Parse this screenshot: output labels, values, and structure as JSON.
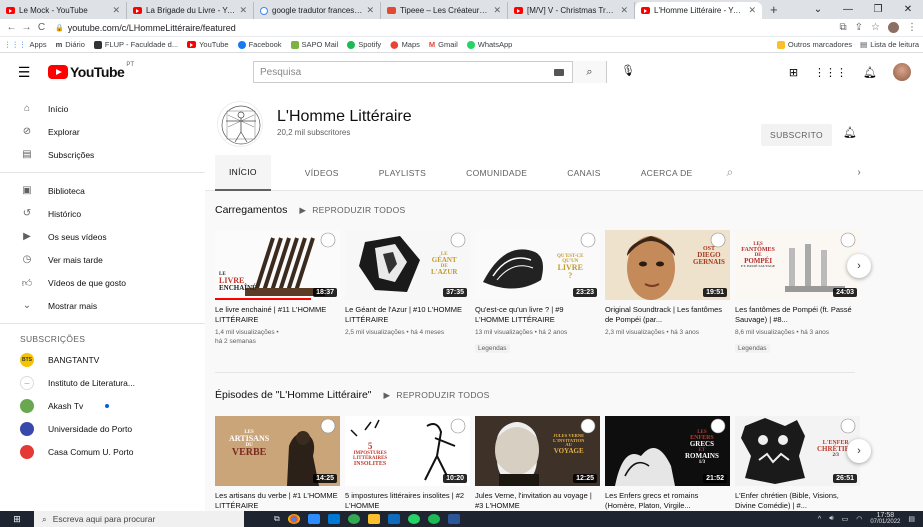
{
  "browser": {
    "tabs": [
      {
        "title": "Le Mock - YouTube",
        "icon": "youtube-icon"
      },
      {
        "title": "La Brigade du Livre - YouTu",
        "icon": "youtube-icon"
      },
      {
        "title": "google tradutor frances - N",
        "icon": "google-icon"
      },
      {
        "title": "Tipeee – Les Créateurs Litt",
        "icon": "tipeee-icon"
      },
      {
        "title": "[M/V] V - Christmas Tree :",
        "icon": "youtube-icon"
      },
      {
        "title": "L'Homme Littéraire - YouTu",
        "icon": "youtube-icon"
      }
    ],
    "url": "youtube.com/c/LHommeLittéraire/featured",
    "bookmarks": [
      "Apps",
      "Diário",
      "FLUP - Faculdade d...",
      "YouTube",
      "Facebook",
      "SAPO Mail",
      "Spotify",
      "Maps",
      "Gmail",
      "WhatsApp"
    ],
    "bookmarks_right": [
      "Outros marcadores",
      "Lista de leitura"
    ]
  },
  "youtube": {
    "logo_text": "YouTube",
    "logo_region": "PT",
    "search_placeholder": "Pesquisa"
  },
  "sidebar": {
    "main": [
      "Início",
      "Explorar",
      "Subscrições"
    ],
    "library": [
      "Biblioteca",
      "Histórico",
      "Os seus vídeos",
      "Ver mais tarde",
      "Vídeos de que gosto",
      "Mostrar mais"
    ],
    "subs_heading": "SUBSCRIÇÕES",
    "subs": [
      {
        "name": "BANGTANTV",
        "color": "#f5c400",
        "badge": "BTS"
      },
      {
        "name": "Instituto de Literatura...",
        "color": "#ffffff",
        "badge": ""
      },
      {
        "name": "Akash Tv",
        "color": "#6aa84f",
        "badge": ""
      },
      {
        "name": "Universidade do Porto",
        "color": "#3949ab",
        "badge": ""
      },
      {
        "name": "Casa Comum U. Porto",
        "color": "#e53935",
        "badge": ""
      }
    ]
  },
  "channel": {
    "name": "L'Homme Littéraire",
    "subscribers": "20,2 mil subscritores",
    "subscribe_label": "SUBSCRITO",
    "tabs": [
      "INÍCIO",
      "VÍDEOS",
      "PLAYLISTS",
      "COMUNIDADE",
      "CANAIS",
      "ACERCA DE"
    ]
  },
  "sections": [
    {
      "title": "Carregamentos",
      "play_all": "REPRODUZIR TODOS",
      "videos": [
        {
          "title": "Le livre enchainé | #11 L'HOMME LITTÉRAIRE",
          "meta1": "1,4 mil visualizações •",
          "meta2": "há 2 semanas",
          "duration": "18:37",
          "badge": "",
          "thumb_text": [
            "LE",
            "LIVRE",
            "ENCHAÎNÉ"
          ]
        },
        {
          "title": "Le Géant de l'Azur | #10 L'HOMME LITTÉRAIRE",
          "meta1": "2,5 mil visualizações • há 4 meses",
          "meta2": "",
          "duration": "37:35",
          "badge": "",
          "thumb_text": [
            "LE",
            "GÉANT",
            "DE",
            "L'AZUR"
          ]
        },
        {
          "title": "Qu'est-ce qu'un livre ? | #9 L'HOMME LITTÉRAIRE",
          "meta1": "13 mil visualizações • há 2 anos",
          "meta2": "",
          "duration": "23:23",
          "badge": "Legendas",
          "thumb_text": [
            "QU'EST-CE",
            "QU'UN",
            "LIVRE",
            "?"
          ]
        },
        {
          "title": "Original Soundtrack | Les fantômes de Pompéi (par...",
          "meta1": "2,3 mil visualizações • há 3 anos",
          "meta2": "",
          "duration": "19:51",
          "badge": "",
          "thumb_text": [
            "OST",
            "DIEGO",
            "GERNAIS"
          ]
        },
        {
          "title": "Les fantômes de Pompéi (ft. Passé Sauvage) | #8...",
          "meta1": "8,6 mil visualizações • há 3 anos",
          "meta2": "",
          "duration": "24:03",
          "badge": "Legendas",
          "thumb_text": [
            "LES",
            "FANTÔMES",
            "DE",
            "POMPÉI",
            "FT. PASSÉ SAUVAGE"
          ]
        }
      ]
    },
    {
      "title": "Épisodes de \"L'Homme Littéraire\"",
      "play_all": "REPRODUZIR TODOS",
      "videos": [
        {
          "title": "Les artisans du verbe | #1 L'HOMME LITTÉRAIRE",
          "duration": "14:25",
          "thumb_text": [
            "LES",
            "ARTISANS",
            "DU",
            "VERBE"
          ]
        },
        {
          "title": "5 impostures littéraires insolites | #2 L'HOMME",
          "duration": "10:20",
          "thumb_text": [
            "5",
            "IMPOSTURES",
            "LITTÉRAIRES",
            "INSOLITES"
          ]
        },
        {
          "title": "Jules Verne, l'invitation au voyage | #3 L'HOMME",
          "duration": "12:25",
          "thumb_text": [
            "JULES VERNE",
            "L'INVITATION",
            "AU",
            "VOYAGE"
          ]
        },
        {
          "title": "Les Enfers grecs et romains (Homère, Platon, Virgile...",
          "duration": "21:52",
          "thumb_text": [
            "LES",
            "ENFERS",
            "GRECS",
            "ET",
            "ROMAINS",
            "1/3"
          ]
        },
        {
          "title": "L'Enfer chrétien (Bible, Visions, Divine Comédie) | #...",
          "duration": "26:51",
          "thumb_text": [
            "L'ENFER",
            "CHRÉTIEN",
            "2/3"
          ]
        }
      ]
    }
  ],
  "taskbar": {
    "search_placeholder": "Escreva aqui para procurar",
    "time": "17:58",
    "date": "07/01/2022"
  }
}
